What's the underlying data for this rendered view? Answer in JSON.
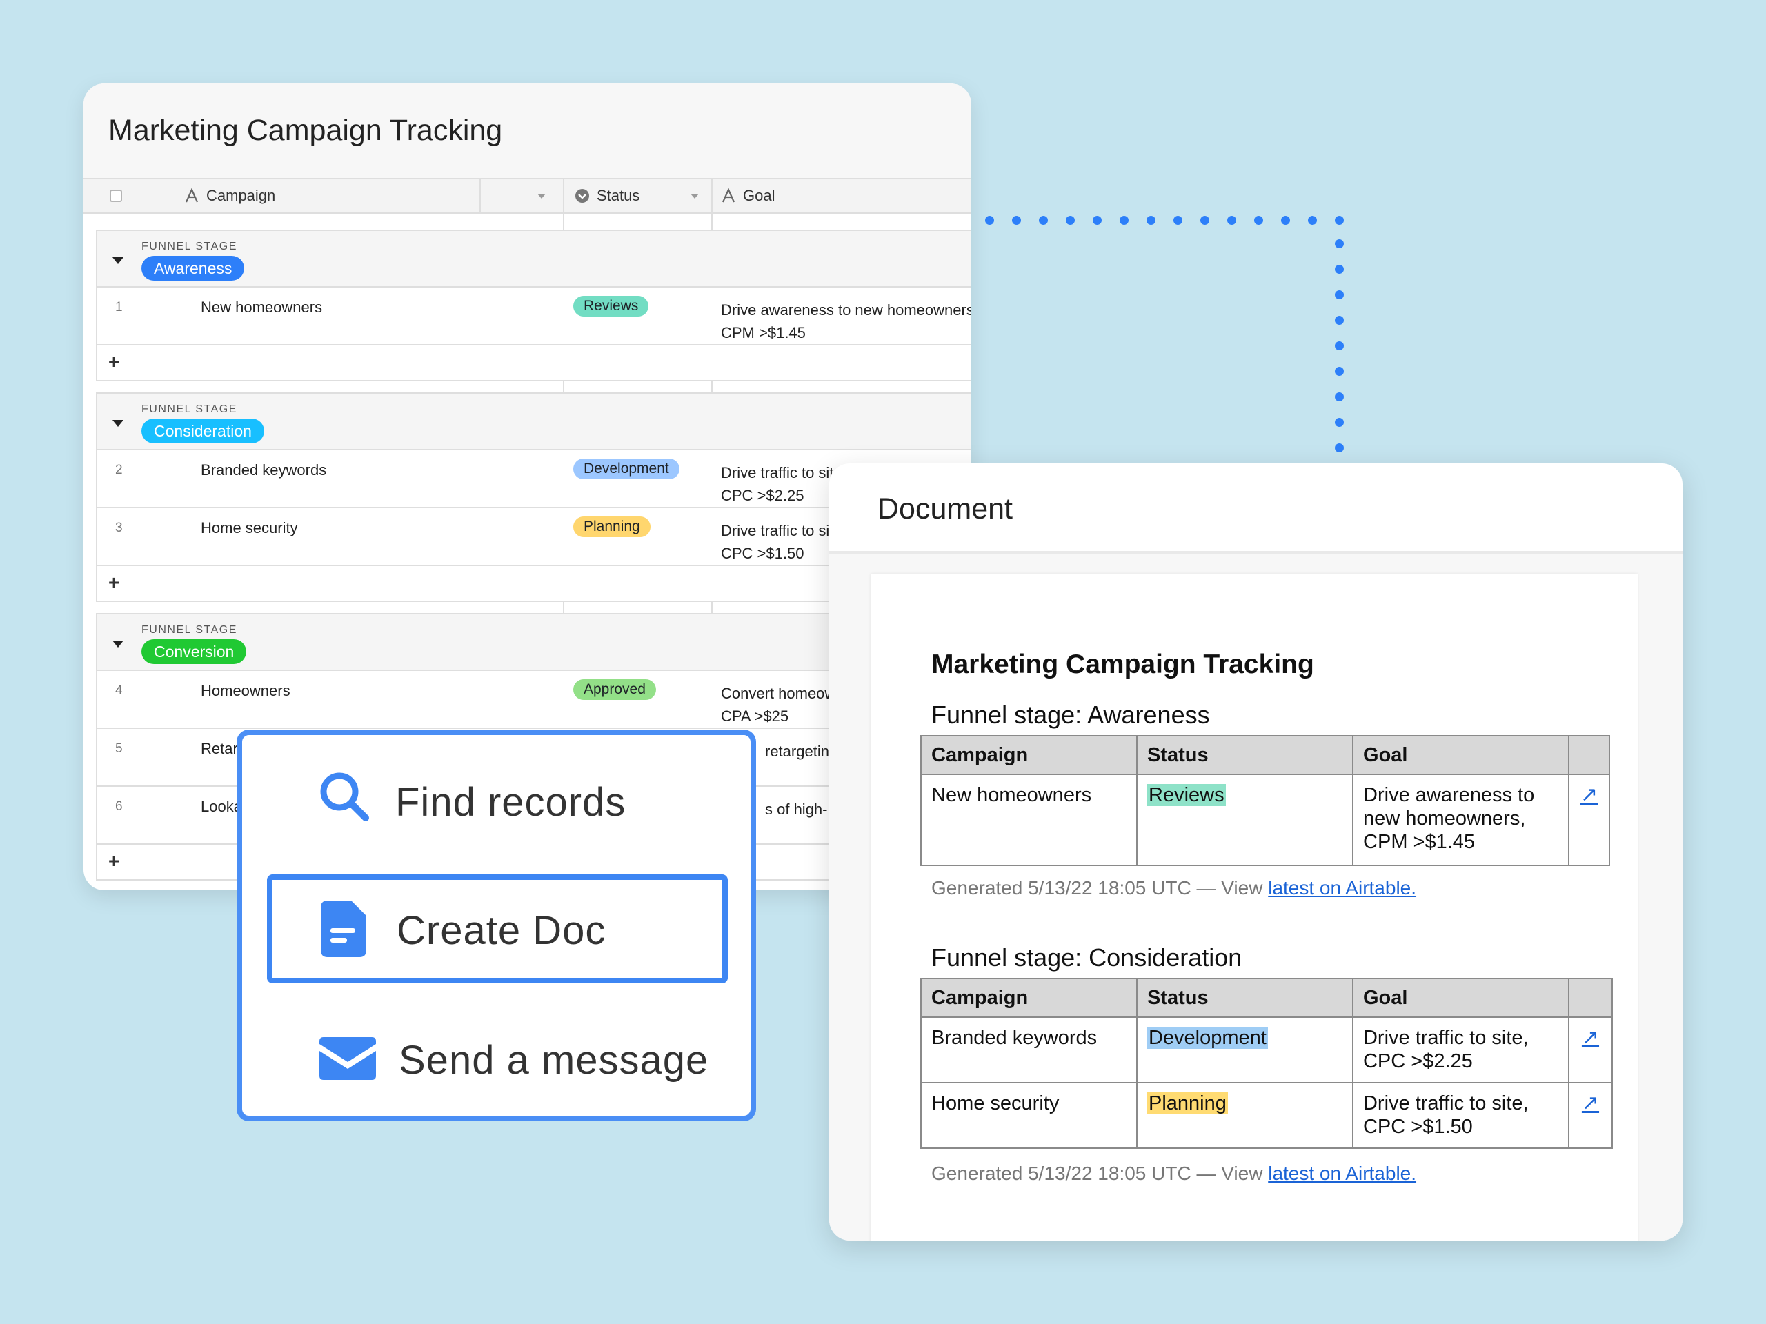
{
  "sheet": {
    "title": "Marketing Campaign Tracking",
    "columns": {
      "campaign": "Campaign",
      "status": "Status",
      "goal": "Goal"
    },
    "column_icons": {
      "campaign": "text-field-icon",
      "status": "single-select-icon",
      "goal": "text-field-icon"
    },
    "group_label": "FUNNEL STAGE",
    "groups": [
      {
        "name": "Awareness",
        "color": "#2d7ff9",
        "rows": [
          {
            "num": "1",
            "campaign": "New homeowners",
            "status": "Reviews",
            "status_color": "#72ddc3",
            "goal1": "Drive awareness to new homeowners",
            "goal2": "CPM >$1.45"
          }
        ]
      },
      {
        "name": "Consideration",
        "color": "#18bfff",
        "rows": [
          {
            "num": "2",
            "campaign": "Branded keywords",
            "status": "Development",
            "status_color": "#9cc7ff",
            "goal1": "Drive traffic to site",
            "goal2": "CPC >$2.25"
          },
          {
            "num": "3",
            "campaign": "Home security",
            "status": "Planning",
            "status_color": "#ffd66e",
            "goal1": "Drive traffic to site",
            "goal2": "CPC >$1.50"
          }
        ]
      },
      {
        "name": "Conversion",
        "color": "#20c933",
        "rows": [
          {
            "num": "4",
            "campaign": "Homeowners",
            "status": "Approved",
            "status_color": "#93e088",
            "goal1": "Convert homeowners,",
            "goal2": "CPA >$25"
          },
          {
            "num": "5",
            "campaign": "Retarge",
            "status": "",
            "status_color": "",
            "goal1": "retargeting",
            "goal2": ""
          },
          {
            "num": "6",
            "campaign": "Lookali",
            "status": "",
            "status_color": "",
            "goal1": "s of high-",
            "goal2": ""
          }
        ]
      }
    ],
    "add_symbol": "+"
  },
  "actions": {
    "items": [
      {
        "label": "Find records",
        "icon": "search-icon"
      },
      {
        "label": "Create Doc",
        "icon": "document-icon",
        "selected": true
      },
      {
        "label": "Send a message",
        "icon": "envelope-icon"
      }
    ],
    "accent": "#3d86f3"
  },
  "doc": {
    "window_title": "Document",
    "heading": "Marketing Campaign Tracking",
    "columns": [
      "Campaign",
      "Status",
      "Goal"
    ],
    "link_icon": "external-link-icon",
    "footer_prefix": "Generated 5/13/22 18:05 UTC — View ",
    "footer_link": "latest on Airtable.",
    "sections": [
      {
        "title": "Funnel stage: Awareness",
        "rows": [
          {
            "campaign": "New homeowners",
            "status": "Reviews",
            "status_color": "#8ee2c8",
            "goal": "Drive awareness to new homeowners, CPM >$1.45"
          }
        ]
      },
      {
        "title": "Funnel stage: Consideration",
        "rows": [
          {
            "campaign": "Branded keywords",
            "status": "Development",
            "status_color": "#9fcdf5",
            "goal": "Drive traffic to site, CPC >$2.25"
          },
          {
            "campaign": "Home security",
            "status": "Planning",
            "status_color": "#ffdb72",
            "goal": "Drive traffic to site, CPC >$1.50"
          }
        ]
      }
    ]
  }
}
